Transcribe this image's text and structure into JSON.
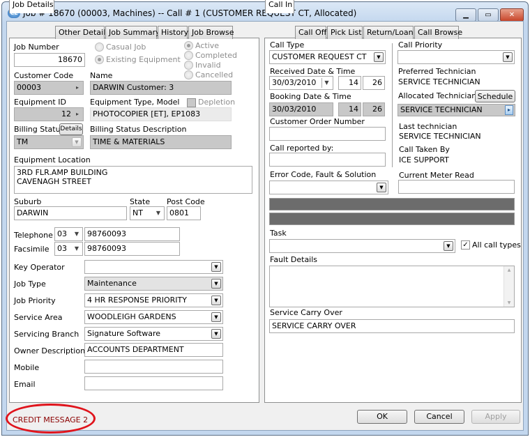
{
  "window": {
    "title": "Job # 18670 (00003, Machines) -- Call # 1 (CUSTOMER REQUEST CT, Allocated)",
    "app_icon": "ce-logo-icon",
    "minimize": "minimize-icon",
    "maximize": "maximize-icon",
    "close": "close-icon"
  },
  "left_tabs": [
    "Job Details",
    "Other Details",
    "Job Summary",
    "History",
    "Job Browse"
  ],
  "job": {
    "job_number_label": "Job Number",
    "job_number": "18670",
    "casual_job": "Casual Job",
    "existing_equipment": "Existing Equipment",
    "job_kind_selected": "Existing Equipment",
    "status_options": [
      "Active",
      "Completed",
      "Invalid",
      "Cancelled"
    ],
    "status_selected": "Active",
    "customer_code_label": "Customer Code",
    "customer_code": "00003",
    "name_label": "Name",
    "name": "DARWIN Customer: 3",
    "equipment_id_label": "Equipment ID",
    "equipment_id": "12",
    "equipment_type_label": "Equipment Type, Model",
    "equipment_type": "PHOTOCOPIER [ET], EP1083",
    "depletion_label": "Depletion",
    "depletion_checked": false,
    "billing_status_label": "Billing Status",
    "details_button": "Details",
    "billing_status": "TM",
    "billing_desc_label": "Billing Status Description",
    "billing_desc": "TIME & MATERIALS",
    "location_label": "Equipment Location",
    "location_line1": "3RD FLR.AMP  BUILDING",
    "location_line2": "CAVENAGH STREET",
    "suburb_label": "Suburb",
    "suburb": "DARWIN",
    "state_label": "State",
    "state": "NT",
    "postcode_label": "Post Code",
    "postcode": "0801",
    "telephone_label": "Telephone",
    "telephone_area": "03",
    "telephone": "98760093",
    "facsimile_label": "Facsimile",
    "facsimile_area": "03",
    "facsimile": "98760093",
    "key_operator_label": "Key Operator",
    "key_operator": "",
    "job_type_label": "Job Type",
    "job_type": "Maintenance",
    "job_priority_label": "Job Priority",
    "job_priority": "4 HR RESPONSE PRIORITY",
    "service_area_label": "Service Area",
    "service_area": "WOODLEIGH GARDENS",
    "servicing_branch_label": "Servicing Branch",
    "servicing_branch": "Signature Software",
    "owner_desc_label": "Owner Description",
    "owner_desc": "ACCOUNTS DEPARTMENT",
    "mobile_label": "Mobile",
    "mobile": "",
    "email_label": "Email",
    "email": ""
  },
  "right_tabs": [
    "Call In",
    "Call Off",
    "Pick List",
    "Return/Loan",
    "Call Browse"
  ],
  "call": {
    "call_type_label": "Call Type",
    "call_type": "CUSTOMER REQUEST CT",
    "call_priority_label": "Call Priority",
    "call_priority": "",
    "received_label": "Received Date & Time",
    "received_date": "30/03/2010",
    "received_hour": "14",
    "received_min": "26",
    "booking_label": "Booking Date & Time",
    "booking_date": "30/03/2010",
    "booking_hour": "14",
    "booking_min": "26",
    "order_label": "Customer Order Number",
    "order": "",
    "reported_label": "Call reported by:",
    "reported": "",
    "error_label": "Error Code,  Fault & Solution",
    "error": "",
    "preferred_label": "Preferred Technician",
    "preferred": "SERVICE TECHNICIAN",
    "allocated_label": "Allocated Technician",
    "schedule_button": "Schedule",
    "allocated": "SERVICE TECHNICIAN",
    "last_label": "Last technician",
    "last": "SERVICE TECHNICIAN",
    "taken_label": "Call Taken By",
    "taken": "ICE SUPPORT",
    "meter_label": "Current Meter Read",
    "meter": "",
    "task_label": "Task",
    "task": "",
    "all_call_types": "All call types",
    "all_call_types_checked": true,
    "fault_label": "Fault Details",
    "fault": "",
    "carry_label": "Service Carry Over",
    "carry": "SERVICE CARRY OVER"
  },
  "footer": {
    "credit_message": "CREDIT MESSAGE 2",
    "ok": "OK",
    "cancel": "Cancel",
    "apply": "Apply"
  }
}
